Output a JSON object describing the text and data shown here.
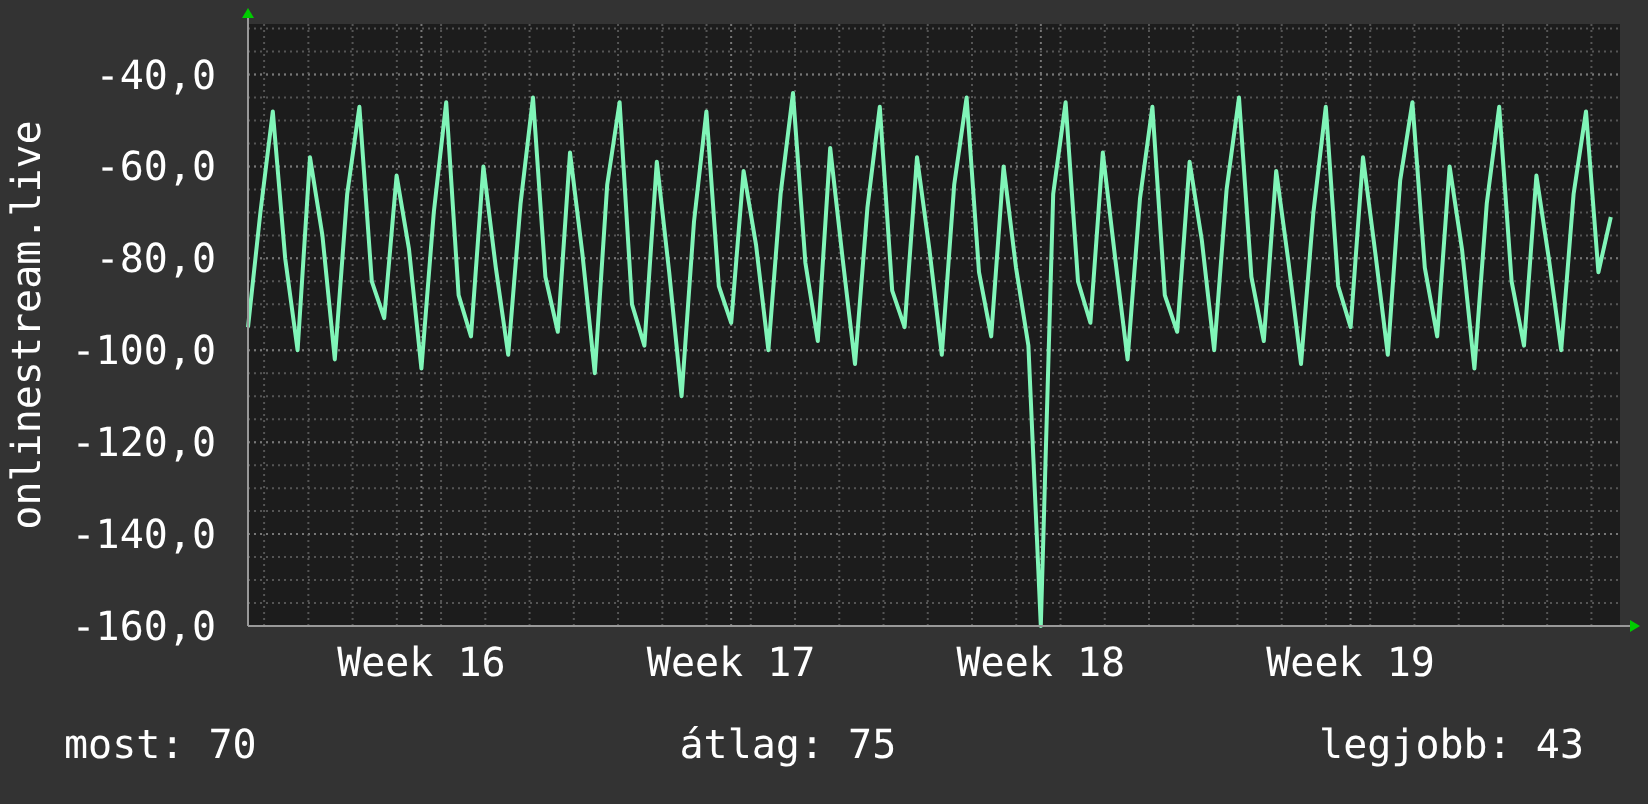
{
  "chart": {
    "chart_data": {
      "type": "line",
      "grid": true,
      "ylabel": "onlinestream.live",
      "ylim": [
        -160,
        -29
      ],
      "yticks": [
        {
          "value": -40,
          "label": "-40,0"
        },
        {
          "value": -60,
          "label": "-60,0"
        },
        {
          "value": -80,
          "label": "-80,0"
        },
        {
          "value": -100,
          "label": "-100,0"
        },
        {
          "value": -120,
          "label": "-120,0"
        },
        {
          "value": -140,
          "label": "-140,0"
        },
        {
          "value": -160,
          "label": "-160,0"
        }
      ],
      "categories": [
        null,
        null,
        null,
        null,
        null,
        null,
        null,
        null,
        null,
        null,
        null,
        null,
        null,
        null,
        "Week 16",
        null,
        null,
        null,
        null,
        null,
        null,
        null,
        null,
        null,
        null,
        null,
        null,
        null,
        null,
        null,
        null,
        null,
        null,
        null,
        null,
        null,
        null,
        null,
        null,
        "Week 17",
        null,
        null,
        null,
        null,
        null,
        null,
        null,
        null,
        null,
        null,
        null,
        null,
        null,
        null,
        null,
        null,
        null,
        null,
        null,
        null,
        null,
        null,
        null,
        null,
        "Week 18",
        null,
        null,
        null,
        null,
        null,
        null,
        null,
        null,
        null,
        null,
        null,
        null,
        null,
        null,
        null,
        null,
        null,
        null,
        null,
        null,
        null,
        null,
        null,
        null,
        "Week 19",
        null,
        null,
        null,
        null,
        null,
        null,
        null,
        null,
        null,
        null,
        null,
        null,
        null,
        null,
        null,
        null,
        null,
        null,
        null,
        null,
        null
      ],
      "series": [
        {
          "color": "#80f5b8",
          "values": [
            -95,
            -70,
            -48,
            -80,
            -100,
            -58,
            -75,
            -102,
            -66,
            -47,
            -85,
            -93,
            -62,
            -78,
            -104,
            -70,
            -46,
            -88,
            -97,
            -60,
            -82,
            -101,
            -68,
            -45,
            -84,
            -96,
            -57,
            -79,
            -105,
            -64,
            -46,
            -90,
            -99,
            -59,
            -83,
            -110,
            -72,
            -48,
            -86,
            -94,
            -61,
            -77,
            -100,
            -66,
            -44,
            -81,
            -98,
            -56,
            -80,
            -103,
            -69,
            -47,
            -87,
            -95,
            -58,
            -78,
            -101,
            -64,
            -45,
            -83,
            -97,
            -60,
            -82,
            -99,
            -160,
            -66,
            -46,
            -85,
            -94,
            -57,
            -80,
            -102,
            -67,
            -47,
            -88,
            -96,
            -59,
            -76,
            -100,
            -65,
            -45,
            -84,
            -98,
            -61,
            -81,
            -103,
            -70,
            -47,
            -86,
            -95,
            -58,
            -79,
            -101,
            -63,
            -46,
            -82,
            -97,
            -60,
            -78,
            -104,
            -68,
            -47,
            -85,
            -99,
            -62,
            -80,
            -100,
            -66,
            -48,
            -83,
            -71
          ]
        }
      ]
    }
  },
  "stats": [
    "most: 70",
    "átlag: 75",
    "legjobb: 43"
  ]
}
